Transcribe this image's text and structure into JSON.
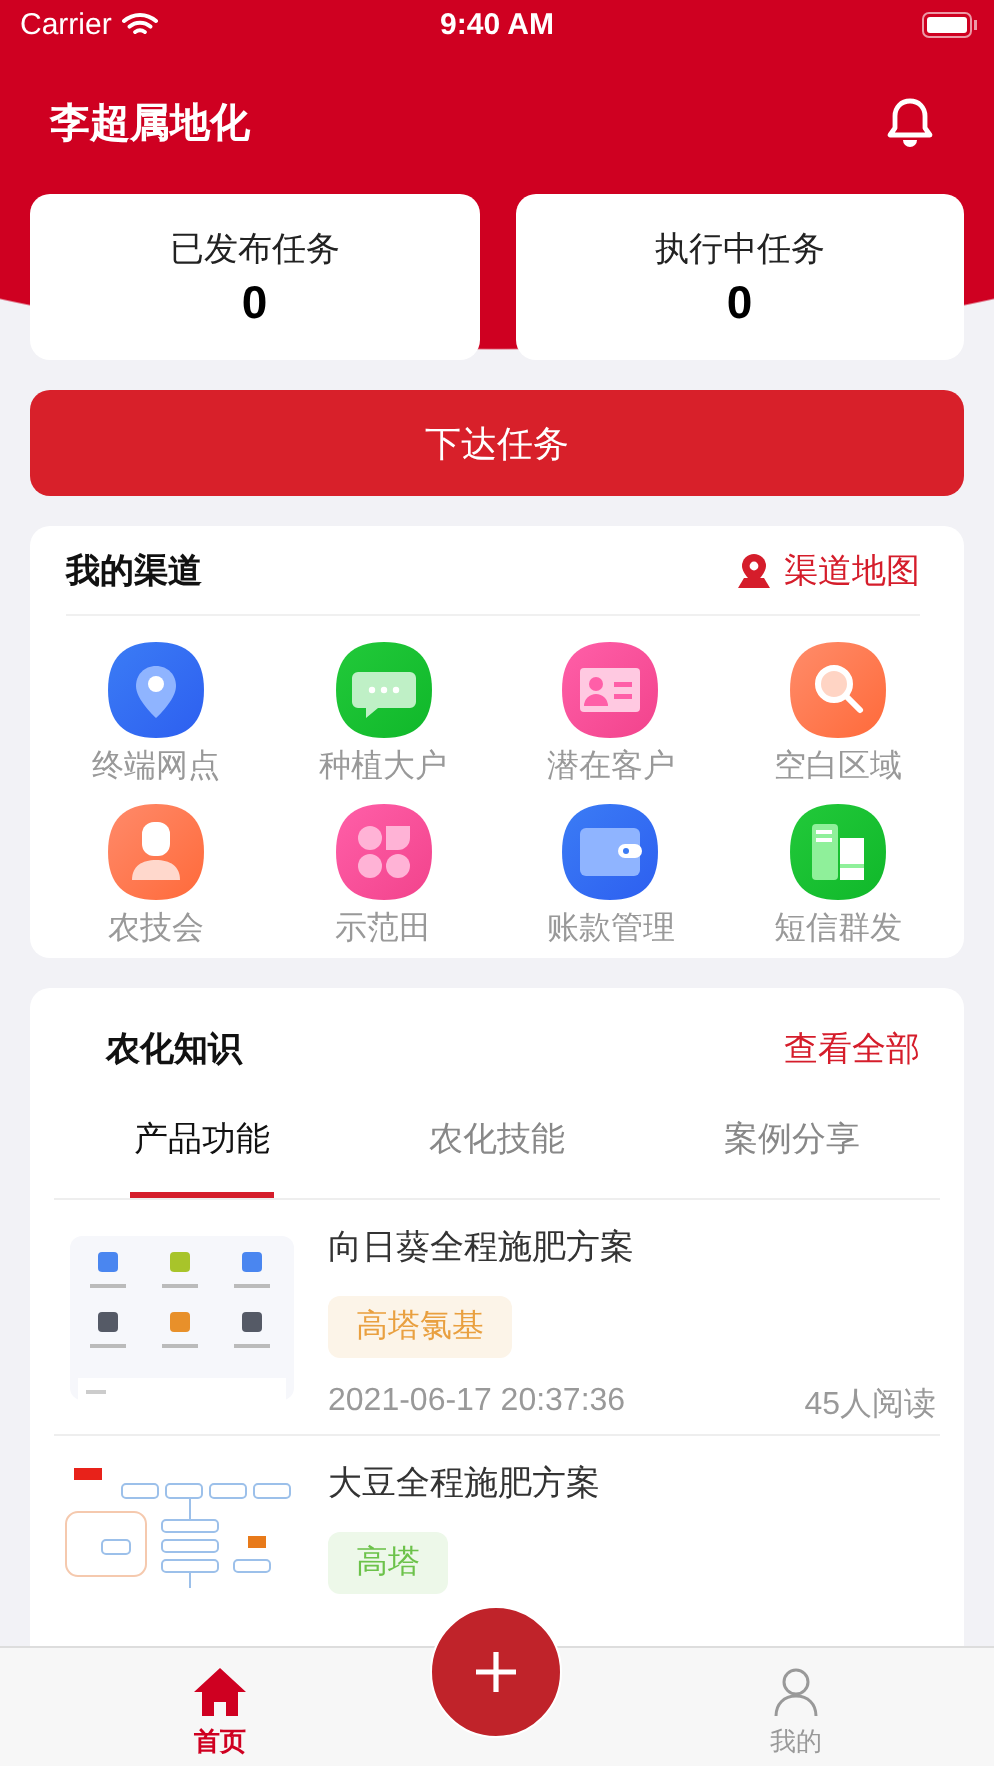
{
  "status_bar": {
    "carrier": "Carrier",
    "time": "9:40 AM"
  },
  "header": {
    "title": "李超属地化"
  },
  "stats": [
    {
      "label": "已发布任务",
      "value": "0"
    },
    {
      "label": "执行中任务",
      "value": "0"
    }
  ],
  "action_button": "下达任务",
  "channels": {
    "title": "我的渠道",
    "map_link": "渠道地图",
    "items": [
      {
        "label": "终端网点"
      },
      {
        "label": "种植大户"
      },
      {
        "label": "潜在客户"
      },
      {
        "label": "空白区域"
      },
      {
        "label": "农技会"
      },
      {
        "label": "示范田"
      },
      {
        "label": "账款管理"
      },
      {
        "label": "短信群发"
      }
    ]
  },
  "knowledge": {
    "title": "农化知识",
    "view_all": "查看全部",
    "tabs": [
      {
        "label": "产品功能",
        "selected": true
      },
      {
        "label": "农化技能",
        "selected": false
      },
      {
        "label": "案例分享",
        "selected": false
      }
    ],
    "articles": [
      {
        "title": "向日葵全程施肥方案",
        "tag": "高塔氯基",
        "color": "#e9a040",
        "date": "2021-06-17 20:37:36",
        "reads": "45人阅读"
      },
      {
        "title": "大豆全程施肥方案",
        "tag": "高塔",
        "color": "#6cc24a"
      }
    ]
  },
  "tab_bar": {
    "items": [
      {
        "label": "首页",
        "selected": true
      },
      {
        "label": "我的",
        "selected": false
      }
    ]
  }
}
